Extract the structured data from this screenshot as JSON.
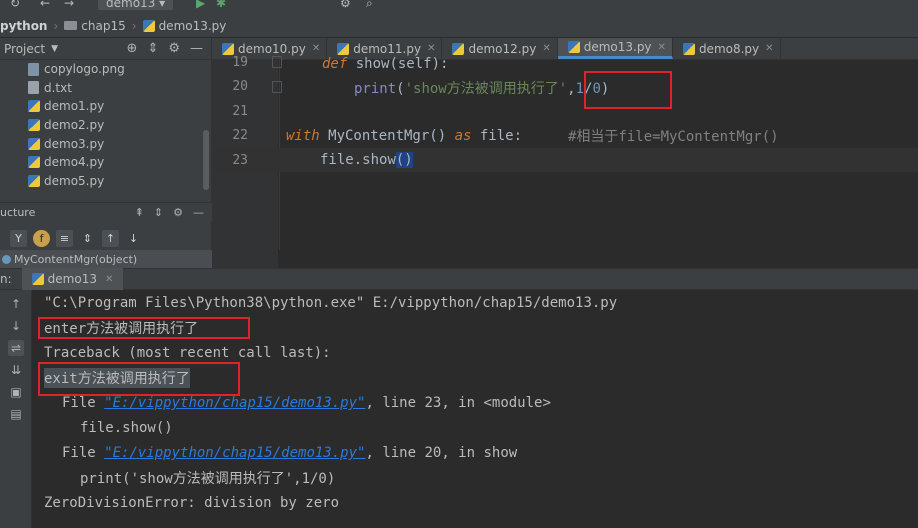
{
  "toolbar": {
    "run_config": "demo13"
  },
  "breadcrumb": {
    "project": "python",
    "folder": "chap15",
    "file": "demo13.py"
  },
  "project_pane": {
    "title": "Project",
    "files": [
      "copylogo.png",
      "d.txt",
      "demo1.py",
      "demo2.py",
      "demo3.py",
      "demo4.py",
      "demo5.py"
    ]
  },
  "structure": {
    "title": "ucture",
    "item": "MyContentMgr(object)"
  },
  "tabs": [
    {
      "label": "demo10.py"
    },
    {
      "label": "demo11.py"
    },
    {
      "label": "demo12.py"
    },
    {
      "label": "demo13.py"
    },
    {
      "label": "demo8.py"
    }
  ],
  "editor": {
    "line_numbers": [
      "19",
      "20",
      "21",
      "22",
      "23"
    ],
    "line19": {
      "def": "def",
      "name": " show(self):"
    },
    "line20": {
      "print": "print",
      "open": "(",
      "string": "'show方法被调用执行了'",
      "comma": ",",
      "num1": "1",
      "slash": "/",
      "num2": "0",
      "close": ")"
    },
    "line22": {
      "with": "with",
      "cls": " MyContentMgr() ",
      "as": "as",
      "var": " file:",
      "comment": "#相当于file=MyContentMgr()"
    },
    "line23": {
      "obj": "file.",
      "call": "show",
      "paren": "()"
    }
  },
  "run": {
    "label": "n:",
    "tab": "demo13"
  },
  "console": {
    "lines": [
      "\"C:\\Program Files\\Python38\\python.exe\" E:/vippython/chap15/demo13.py",
      "enter方法被调用执行了",
      "Traceback (most recent call last):",
      "exit方法被调用执行了",
      "line 23, in <module>",
      "file.show()",
      "line 20, in show",
      "print('show方法被调用执行了',1/0)",
      "ZeroDivisionError: division by zero"
    ],
    "file_prefix": "File ",
    "link_path": "\"E:/vippython/chap15/demo13.py\"",
    "link_sep": ", "
  }
}
